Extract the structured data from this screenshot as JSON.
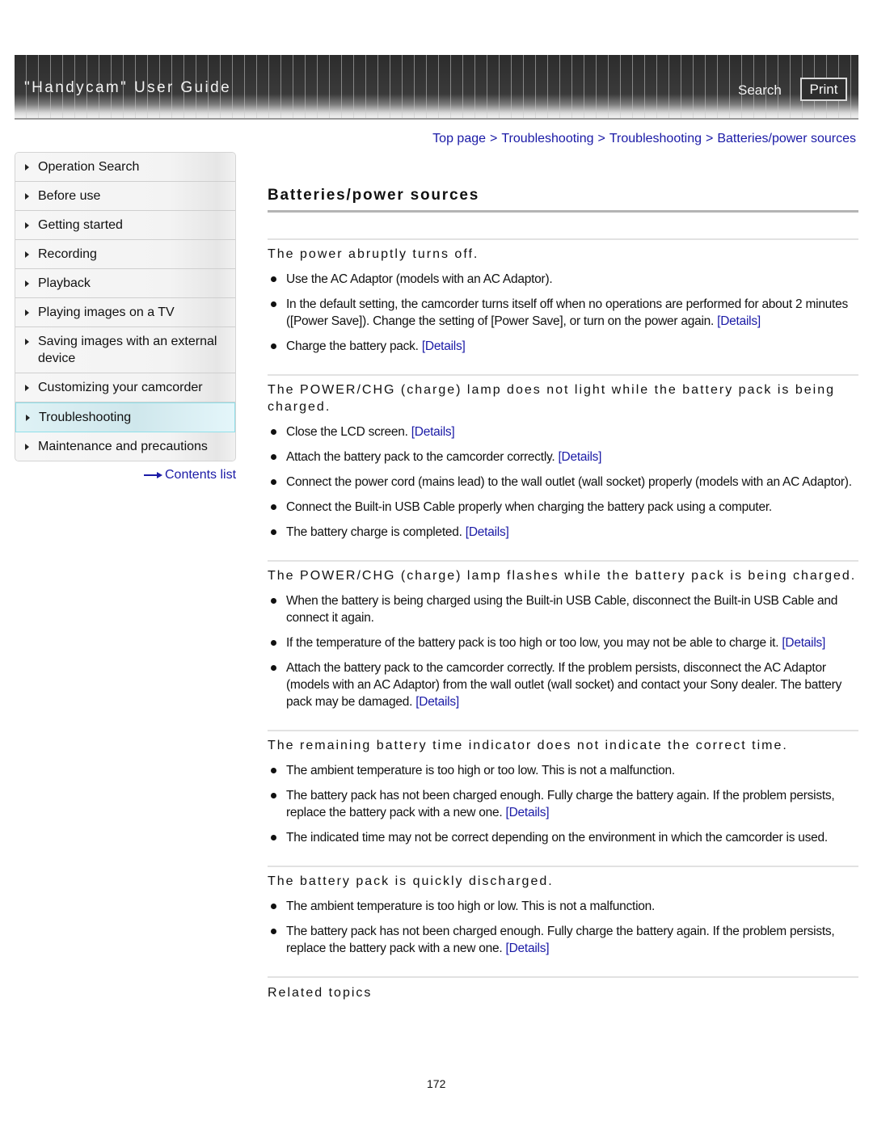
{
  "header": {
    "title": "\"Handycam\" User Guide",
    "search_label": "Search",
    "print_label": "Print"
  },
  "breadcrumb": [
    "Top page",
    "Troubleshooting",
    "Troubleshooting",
    "Batteries/power sources"
  ],
  "breadcrumb_separator": ">",
  "sidebar": {
    "items": [
      {
        "label": "Operation Search",
        "active": false
      },
      {
        "label": "Before use",
        "active": false
      },
      {
        "label": "Getting started",
        "active": false
      },
      {
        "label": "Recording",
        "active": false
      },
      {
        "label": "Playback",
        "active": false
      },
      {
        "label": "Playing images on a TV",
        "active": false
      },
      {
        "label": "Saving images with an external device",
        "active": false
      },
      {
        "label": "Customizing your camcorder",
        "active": false
      },
      {
        "label": "Troubleshooting",
        "active": true
      },
      {
        "label": "Maintenance and precautions",
        "active": false
      }
    ],
    "contents_list_label": "Contents list"
  },
  "main": {
    "title": "Batteries/power sources",
    "details_label": "[Details]",
    "sections": [
      {
        "heading": "The power abruptly turns off.",
        "items": [
          {
            "text": "Use the AC Adaptor (models with an AC Adaptor).",
            "details": false
          },
          {
            "text": "In the default setting, the camcorder turns itself off when no operations are performed for about 2 minutes ([Power Save]). Change the setting of [Power Save], or turn on the power again.",
            "details": true
          },
          {
            "text": "Charge the battery pack.",
            "details": true
          }
        ]
      },
      {
        "heading": "The POWER/CHG (charge) lamp does not light while the battery pack is being charged.",
        "items": [
          {
            "text": "Close the LCD screen.",
            "details": true
          },
          {
            "text": "Attach the battery pack to the camcorder correctly.",
            "details": true
          },
          {
            "text": "Connect the power cord (mains lead) to the wall outlet (wall socket) properly (models with an AC Adaptor).",
            "details": false
          },
          {
            "text": "Connect the Built-in USB Cable properly when charging the battery pack using a computer.",
            "details": false
          },
          {
            "text": "The battery charge is completed.",
            "details": true
          }
        ]
      },
      {
        "heading": "The POWER/CHG (charge) lamp flashes while the battery pack is being charged.",
        "items": [
          {
            "text": "When the battery is being charged using the Built-in USB Cable, disconnect the Built-in USB Cable and connect it again.",
            "details": false
          },
          {
            "text": "If the temperature of the battery pack is too high or too low, you may not be able to charge it.",
            "details": true
          },
          {
            "text": "Attach the battery pack to the camcorder correctly. If the problem persists, disconnect the AC Adaptor (models with an AC Adaptor) from the wall outlet (wall socket) and contact your Sony dealer. The battery pack may be damaged.",
            "details": true
          }
        ]
      },
      {
        "heading": "The remaining battery time indicator does not indicate the correct time.",
        "items": [
          {
            "text": "The ambient temperature is too high or too low. This is not a malfunction.",
            "details": false
          },
          {
            "text": "The battery pack has not been charged enough. Fully charge the battery again. If the problem persists, replace the battery pack with a new one.",
            "details": true
          },
          {
            "text": "The indicated time may not be correct depending on the environment in which the camcorder is used.",
            "details": false
          }
        ]
      },
      {
        "heading": "The battery pack is quickly discharged.",
        "items": [
          {
            "text": "The ambient temperature is too high or low. This is not a malfunction.",
            "details": false
          },
          {
            "text": "The battery pack has not been charged enough. Fully charge the battery again. If the problem persists, replace the battery pack with a new one.",
            "details": true
          }
        ]
      }
    ],
    "related_topics_label": "Related topics"
  },
  "footer": {
    "page_number": "172"
  },
  "colors": {
    "link": "#1a1aa6",
    "active_nav": "#cfe7ec",
    "header_bg": "#333333"
  }
}
